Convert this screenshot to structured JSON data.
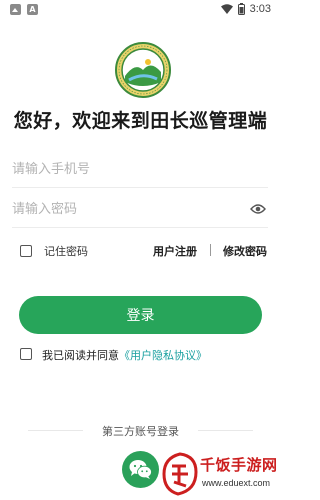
{
  "status_bar": {
    "time": "3:03",
    "left_icons": [
      "photo-icon",
      "a-icon"
    ],
    "right_icons": [
      "wifi-icon",
      "battery-icon"
    ]
  },
  "app": {
    "logo": "app-emblem-icon",
    "welcome": "您好，欢迎来到田长巡管理端"
  },
  "form": {
    "phone_placeholder": "请输入手机号",
    "password_placeholder": "请输入密码",
    "remember_label": "记住密码",
    "register_link": "用户注册",
    "separator": "|",
    "change_password_link": "修改密码",
    "login_button": "登录"
  },
  "agreement": {
    "text": "我已阅读并同意",
    "link": "《用户隐私协议》"
  },
  "third_party": {
    "label": "第三方账号登录",
    "wechat_icon": "wechat-icon"
  },
  "watermark": {
    "name": "千饭手游网",
    "url": "www.eduext.com"
  },
  "colors": {
    "primary_green": "#27a55a",
    "link_teal": "#1aa0a0",
    "watermark_red": "#cc1f1f"
  }
}
